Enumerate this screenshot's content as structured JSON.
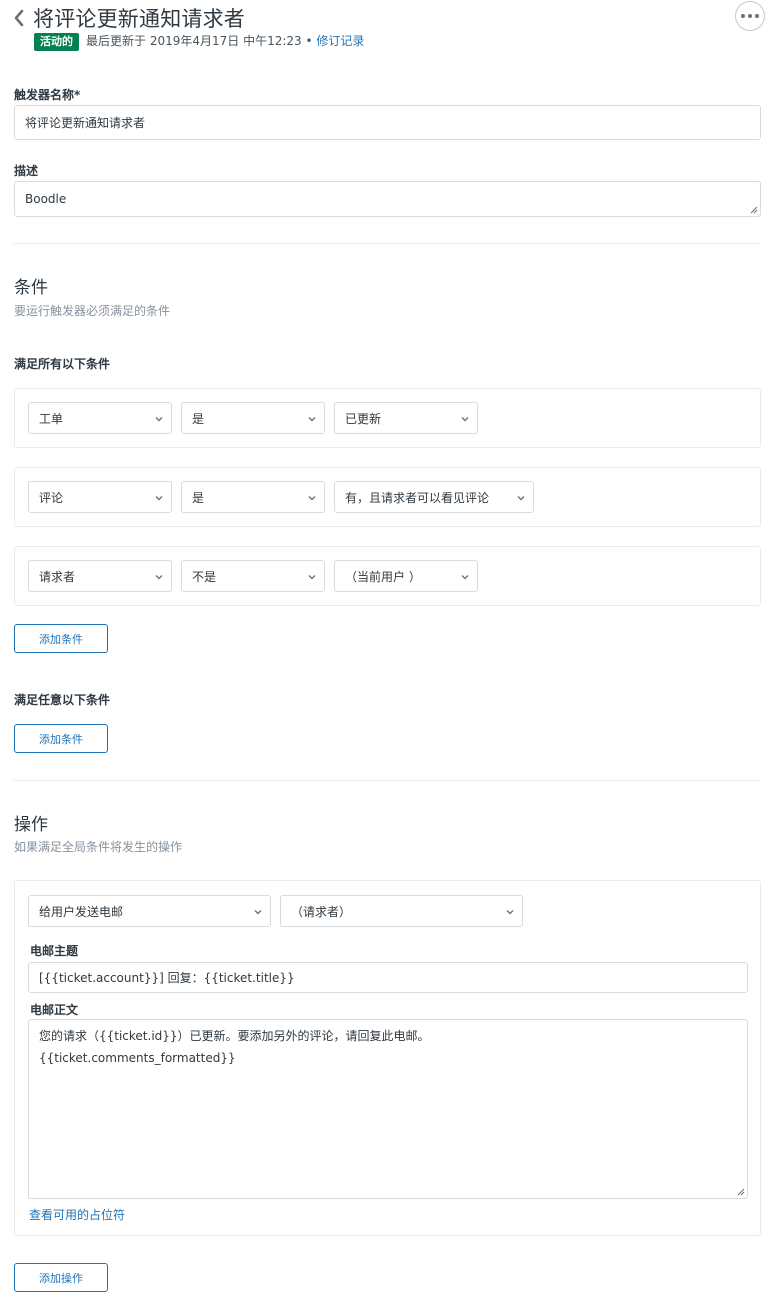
{
  "header": {
    "title": "将评论更新通知请求者",
    "status_badge": "活动的",
    "last_updated": "最后更新于 2019年4月17日 中午12:23 •",
    "revisions_link": "修订记录"
  },
  "form": {
    "name_label": "触发器名称*",
    "name_value": "将评论更新通知请求者",
    "desc_label": "描述",
    "desc_value": "Boodle"
  },
  "conditions": {
    "title": "条件",
    "subtitle": "要运行触发器必须满足的条件",
    "all_label": "满足所有以下条件",
    "rows": [
      {
        "field": "工单",
        "operator": "是",
        "value": "已更新"
      },
      {
        "field": "评论",
        "operator": "是",
        "value": "有，且请求者可以看见评论"
      },
      {
        "field": "请求者",
        "operator": "不是",
        "value": "（当前用户 ）"
      }
    ],
    "add_all_label": "添加条件",
    "any_label": "满足任意以下条件",
    "add_any_label": "添加条件"
  },
  "actions": {
    "title": "操作",
    "subtitle": "如果满足全局条件将发生的操作",
    "action_select": "给用户发送电邮",
    "target_select": "（请求者）",
    "subject_label": "电邮主题",
    "subject_value": "[{{ticket.account}}] 回复：{{ticket.title}}",
    "body_label": "电邮正文",
    "body_line1": "您的请求（{{ticket.id}}）已更新。要添加另外的评论，请回复此电邮。",
    "body_line2": "{{ticket.comments_formatted}}",
    "placeholders_link": "查看可用的占位符",
    "add_action_label": "添加操作"
  },
  "icons": [
    "chevron-left-icon",
    "more-options-icon",
    "chevron-down-icon",
    "resize-grip-icon"
  ],
  "colors": {
    "accent": "#1f73b7",
    "active_badge": "#038153",
    "border": "#d8dcde"
  }
}
